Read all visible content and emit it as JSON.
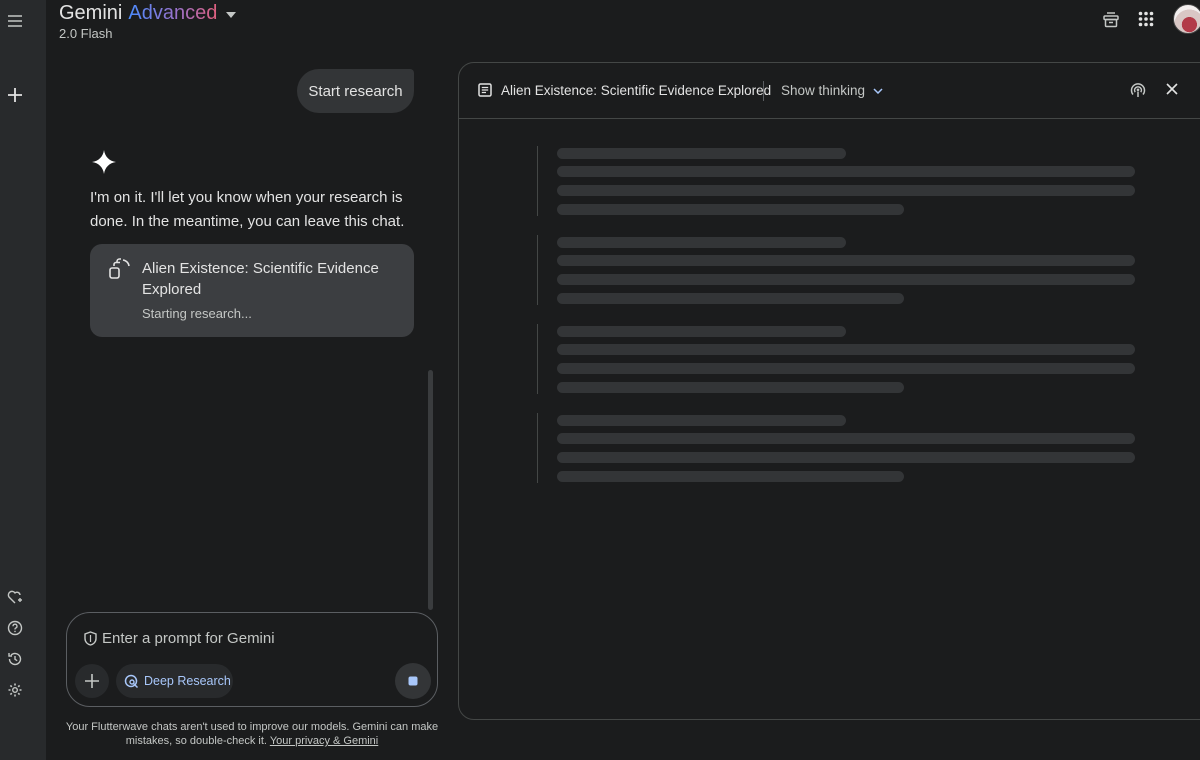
{
  "header": {
    "brand_name": "Gemini",
    "brand_tier": "Advanced",
    "model": "2.0 Flash"
  },
  "icons": {
    "menu": "menu-icon",
    "new_chat": "plus-icon",
    "gems": "gem-icon",
    "help": "help-icon",
    "activity": "history-icon",
    "settings": "gear-icon",
    "top_1": "gift-icon",
    "top_2": "apps-grid-icon"
  },
  "chat": {
    "user_message": "Start research",
    "assistant_reply": "I'm on it. I'll let you know when your research is done. In the meantime, you can leave this chat.",
    "research_card": {
      "title": "Alien Existence: Scientific Evidence Explored",
      "status": "Starting research..."
    }
  },
  "input": {
    "placeholder": "Enter a prompt for Gemini",
    "value": "",
    "deep_research_label": "Deep Research"
  },
  "disclaimer": {
    "text": "Your Flutterwave chats aren't used to improve our models. Gemini can make mistakes, so double-check it.",
    "link": "Your privacy & Gemini"
  },
  "panel": {
    "title": "Alien Existence: Scientific Evidence Explored",
    "show_thinking_label": "Show thinking",
    "state": "loading"
  },
  "colors": {
    "background": "#1b1c1d",
    "rail": "#282a2c",
    "card": "#3c3e41",
    "accent_blue": "#a8c7fa",
    "skeleton": "#333537"
  }
}
